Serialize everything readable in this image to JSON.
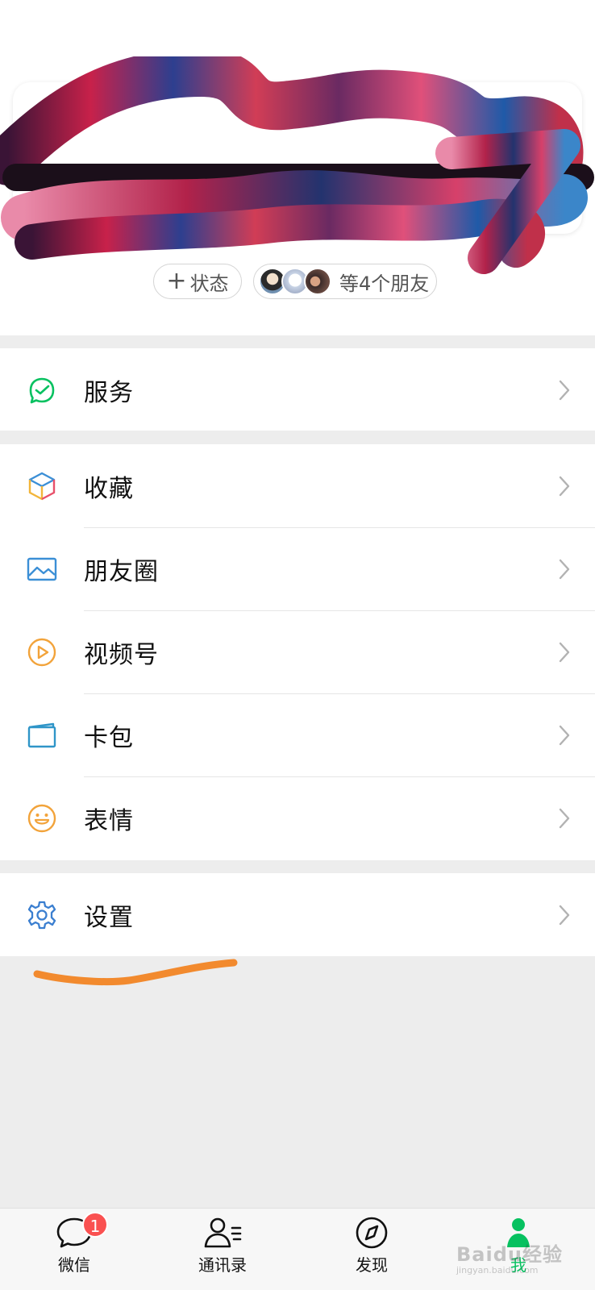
{
  "profile": {
    "status_label": "状态",
    "friends_label": "等4个朋友"
  },
  "menu": {
    "services": {
      "label": "服务",
      "icon": "services-icon"
    },
    "favorites": {
      "label": "收藏",
      "icon": "favorites-cube-icon"
    },
    "moments": {
      "label": "朋友圈",
      "icon": "moments-image-icon"
    },
    "channels": {
      "label": "视频号",
      "icon": "channels-play-icon"
    },
    "cards": {
      "label": "卡包",
      "icon": "card-wallet-icon"
    },
    "stickers": {
      "label": "表情",
      "icon": "smiley-icon"
    },
    "settings": {
      "label": "设置",
      "icon": "gear-icon"
    }
  },
  "tabbar": {
    "chats": {
      "label": "微信",
      "badge": "1"
    },
    "contacts": {
      "label": "通讯录"
    },
    "discover": {
      "label": "发现"
    },
    "me": {
      "label": "我",
      "active": true
    }
  },
  "colors": {
    "accent_green": "#07c160",
    "badge_red": "#fa5151",
    "annotation_orange": "#f28a2e"
  },
  "watermark": {
    "text": "Baidu经验",
    "sub": "jingyan.baidu.com"
  }
}
